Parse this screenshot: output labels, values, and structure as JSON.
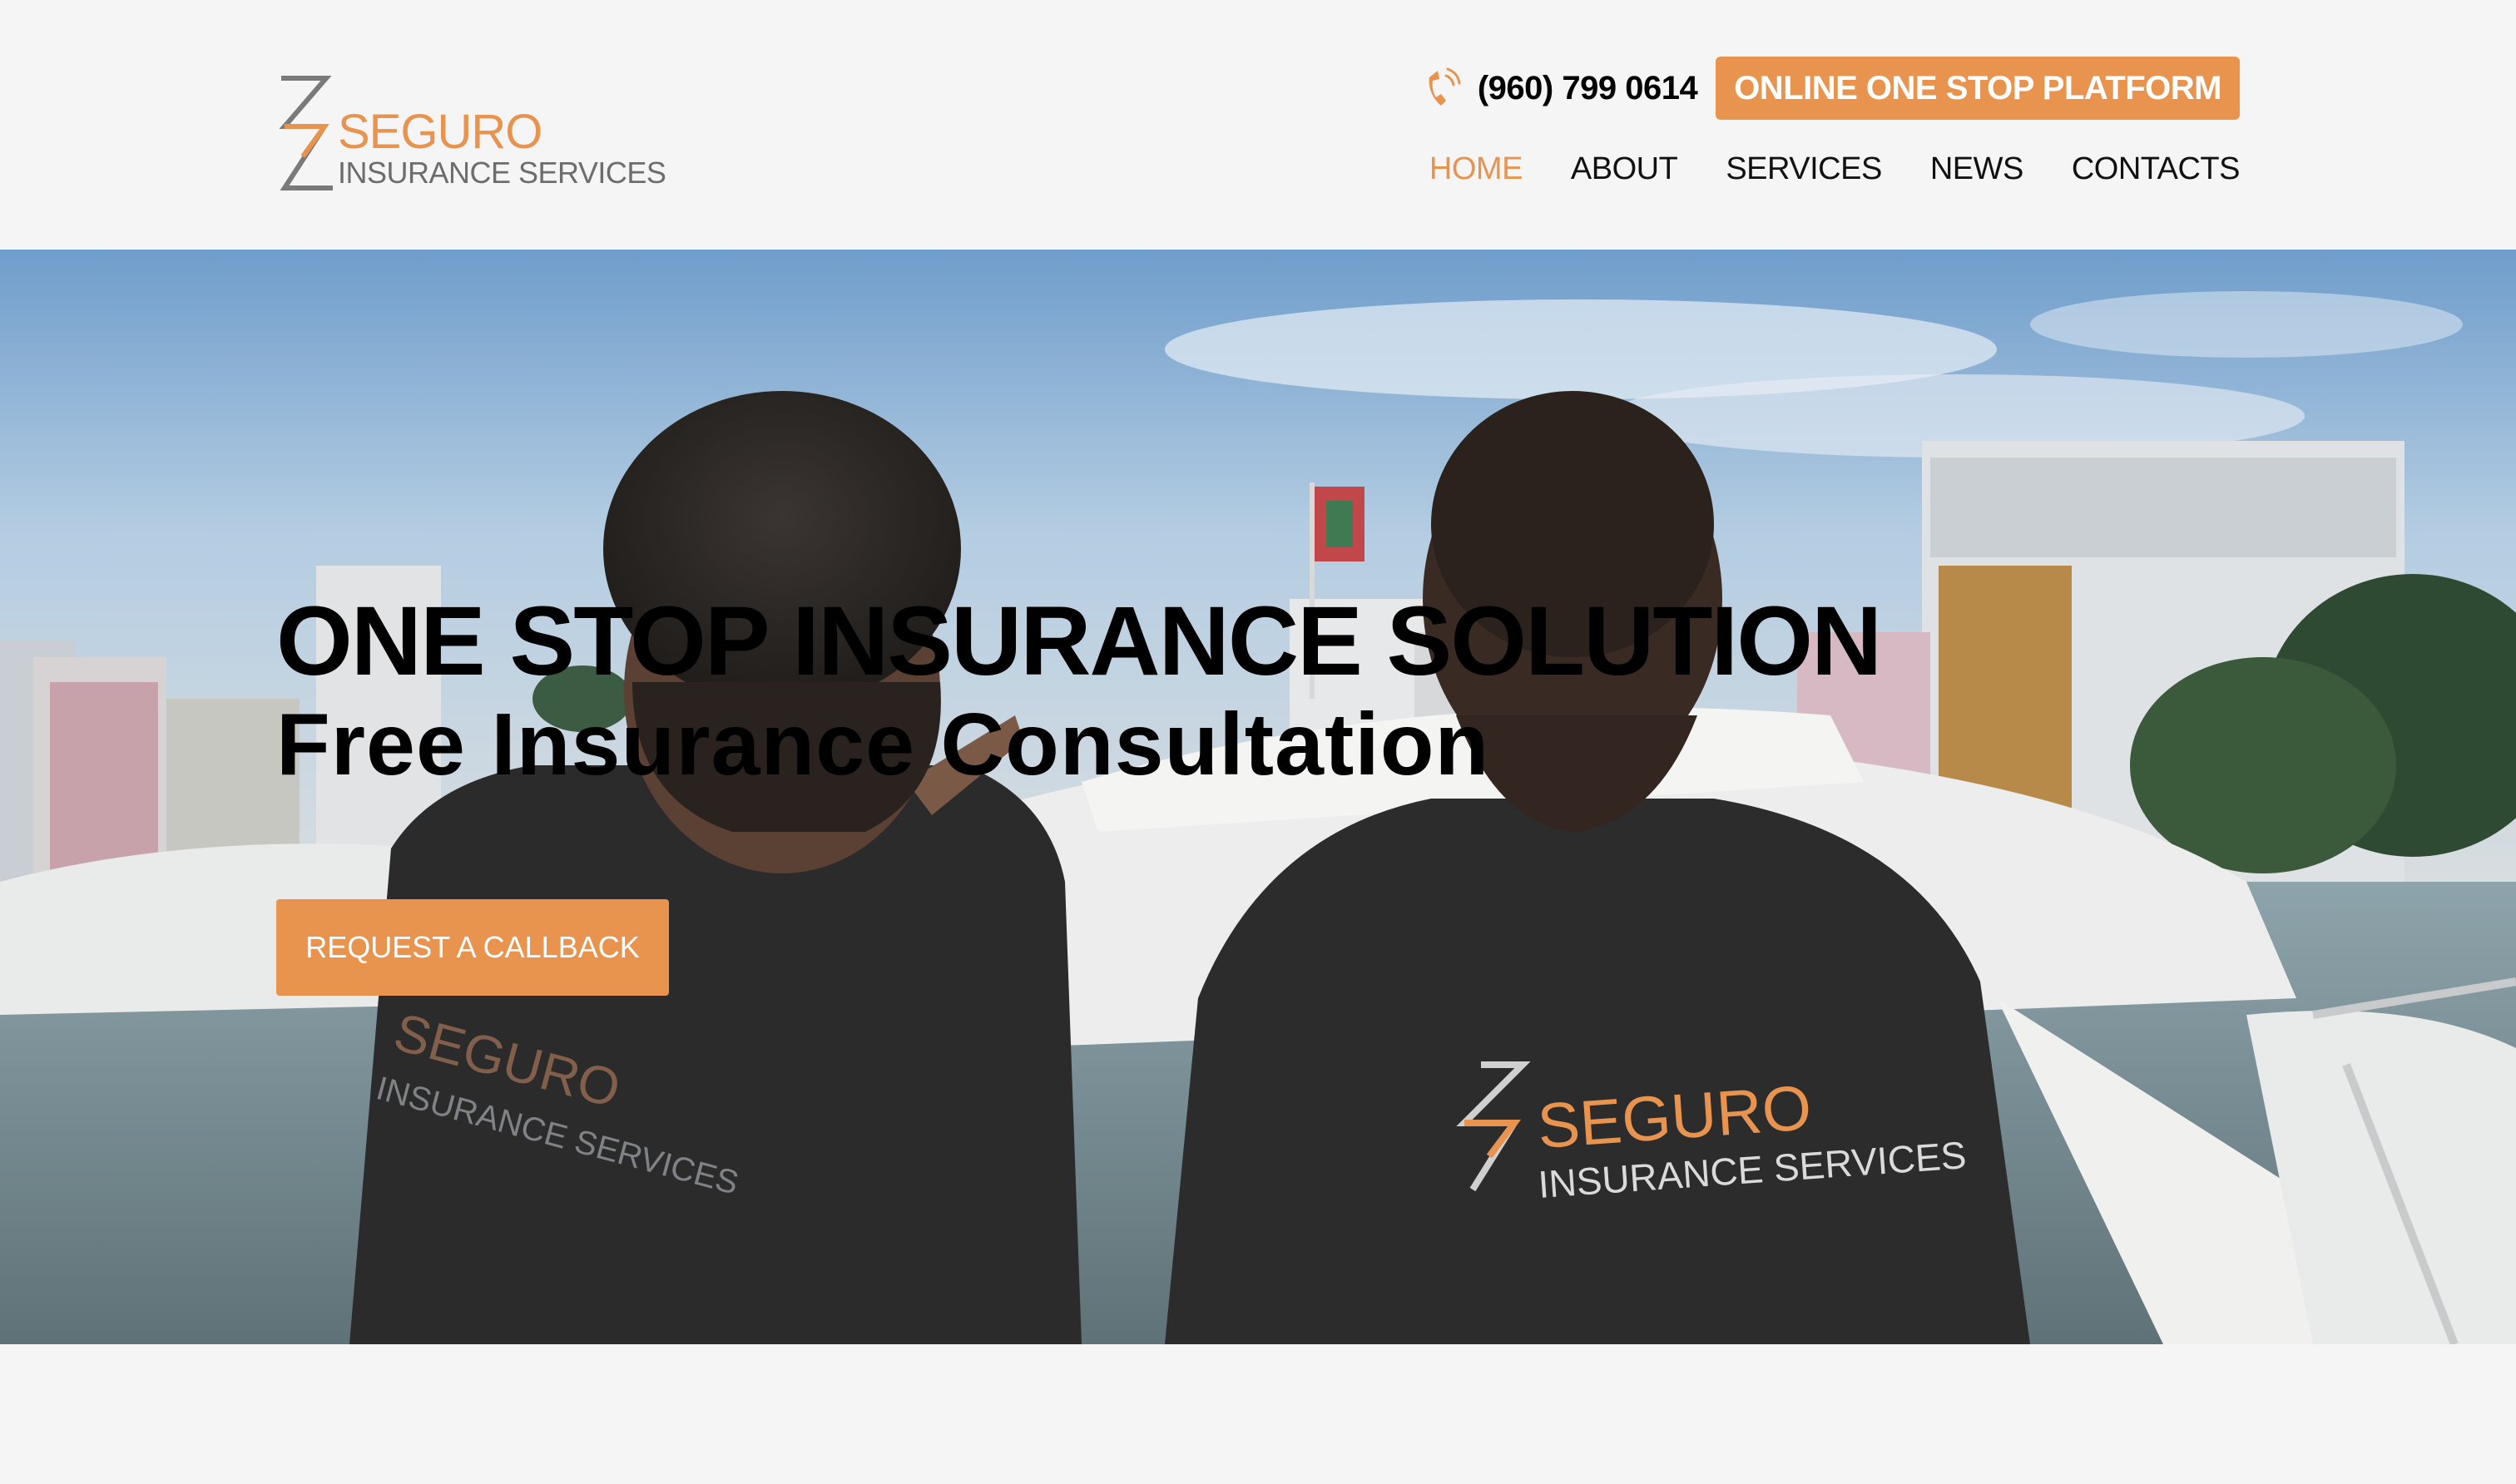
{
  "brand": {
    "name": "SEGURO",
    "tagline": "INSURANCE SERVICES",
    "accent_color": "#e8944f",
    "mark_icon": "seguro-s-logo-icon"
  },
  "header": {
    "phone_icon": "phone-icon",
    "phone": "(960) 799 0614",
    "platform_button": "ONLINE ONE STOP PLATFORM"
  },
  "nav": {
    "items": [
      {
        "label": "HOME",
        "active": true
      },
      {
        "label": "ABOUT",
        "active": false
      },
      {
        "label": "SERVICES",
        "active": false
      },
      {
        "label": "NEWS",
        "active": false
      },
      {
        "label": "CONTACTS",
        "active": false
      }
    ]
  },
  "hero": {
    "title": "ONE STOP INSURANCE SOLUTION",
    "subtitle": "Free Insurance Consultation",
    "cta_label": "REQUEST A CALLBACK",
    "image": "two-men-in-seguro-shirts-at-marina-photo"
  }
}
